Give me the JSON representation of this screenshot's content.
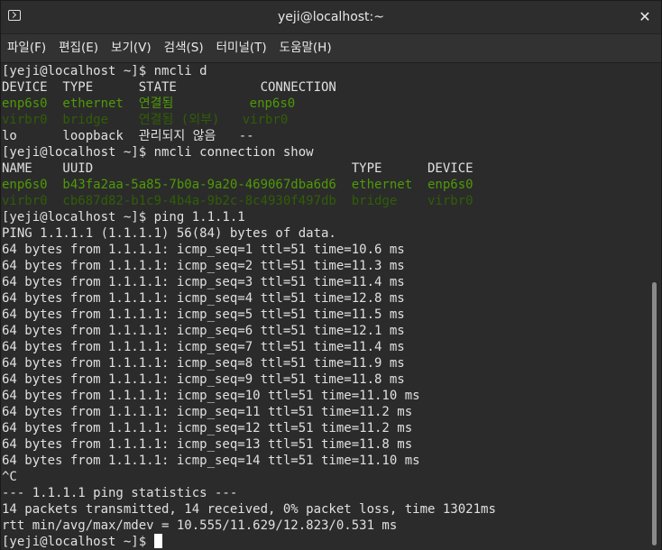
{
  "window": {
    "title": "yeji@localhost:~",
    "close_glyph": "✕"
  },
  "menu": [
    "파일(F)",
    "편집(E)",
    "보기(V)",
    "검색(S)",
    "터미널(T)",
    "도움말(H)"
  ],
  "colors": {
    "background": "#2b2b2b",
    "text": "#e0e0e0",
    "green": "#4e9a06",
    "dim_green": "#305e06"
  },
  "terminal_lines": [
    [
      {
        "t": "[yeji@localhost ~]$ nmcli d"
      }
    ],
    [
      {
        "t": "DEVICE  TYPE      STATE           CONNECTION"
      }
    ],
    [
      {
        "t": "enp6s0  ethernet  연결됨          enp6s0",
        "c": "green"
      }
    ],
    [
      {
        "t": "virbr0  bridge    연결됨 (외부)   virbr0",
        "c": "dim"
      }
    ],
    [
      {
        "t": "lo      loopback  관리되지 않음   --"
      }
    ],
    [
      {
        "t": "[yeji@localhost ~]$ nmcli connection show"
      }
    ],
    [
      {
        "t": "NAME    UUID                                  TYPE      DEVICE"
      }
    ],
    [
      {
        "t": "enp6s0  b43fa2aa-5a85-7b0a-9a20-469067dba6d6  ethernet  enp6s0",
        "c": "green"
      }
    ],
    [
      {
        "t": "virbr0  cb687d82-b1c9-4b4a-9b2c-8c4930f497db  bridge    virbr0",
        "c": "dim"
      }
    ],
    [
      {
        "t": "[yeji@localhost ~]$ ping 1.1.1.1"
      }
    ],
    [
      {
        "t": "PING 1.1.1.1 (1.1.1.1) 56(84) bytes of data."
      }
    ],
    [
      {
        "t": "64 bytes from 1.1.1.1: icmp_seq=1 ttl=51 time=10.6 ms"
      }
    ],
    [
      {
        "t": "64 bytes from 1.1.1.1: icmp_seq=2 ttl=51 time=11.3 ms"
      }
    ],
    [
      {
        "t": "64 bytes from 1.1.1.1: icmp_seq=3 ttl=51 time=11.4 ms"
      }
    ],
    [
      {
        "t": "64 bytes from 1.1.1.1: icmp_seq=4 ttl=51 time=12.8 ms"
      }
    ],
    [
      {
        "t": "64 bytes from 1.1.1.1: icmp_seq=5 ttl=51 time=11.5 ms"
      }
    ],
    [
      {
        "t": "64 bytes from 1.1.1.1: icmp_seq=6 ttl=51 time=12.1 ms"
      }
    ],
    [
      {
        "t": "64 bytes from 1.1.1.1: icmp_seq=7 ttl=51 time=11.4 ms"
      }
    ],
    [
      {
        "t": "64 bytes from 1.1.1.1: icmp_seq=8 ttl=51 time=11.9 ms"
      }
    ],
    [
      {
        "t": "64 bytes from 1.1.1.1: icmp_seq=9 ttl=51 time=11.8 ms"
      }
    ],
    [
      {
        "t": "64 bytes from 1.1.1.1: icmp_seq=10 ttl=51 time=11.10 ms"
      }
    ],
    [
      {
        "t": "64 bytes from 1.1.1.1: icmp_seq=11 ttl=51 time=11.2 ms"
      }
    ],
    [
      {
        "t": "64 bytes from 1.1.1.1: icmp_seq=12 ttl=51 time=11.2 ms"
      }
    ],
    [
      {
        "t": "64 bytes from 1.1.1.1: icmp_seq=13 ttl=51 time=11.8 ms"
      }
    ],
    [
      {
        "t": "64 bytes from 1.1.1.1: icmp_seq=14 ttl=51 time=11.10 ms"
      }
    ],
    [
      {
        "t": "^C"
      }
    ],
    [
      {
        "t": "--- 1.1.1.1 ping statistics ---"
      }
    ],
    [
      {
        "t": "14 packets transmitted, 14 received, 0% packet loss, time 13021ms"
      }
    ],
    [
      {
        "t": "rtt min/avg/max/mdev = 10.555/11.629/12.823/0.531 ms"
      }
    ],
    [
      {
        "t": "[yeji@localhost ~]$ "
      }
    ]
  ]
}
